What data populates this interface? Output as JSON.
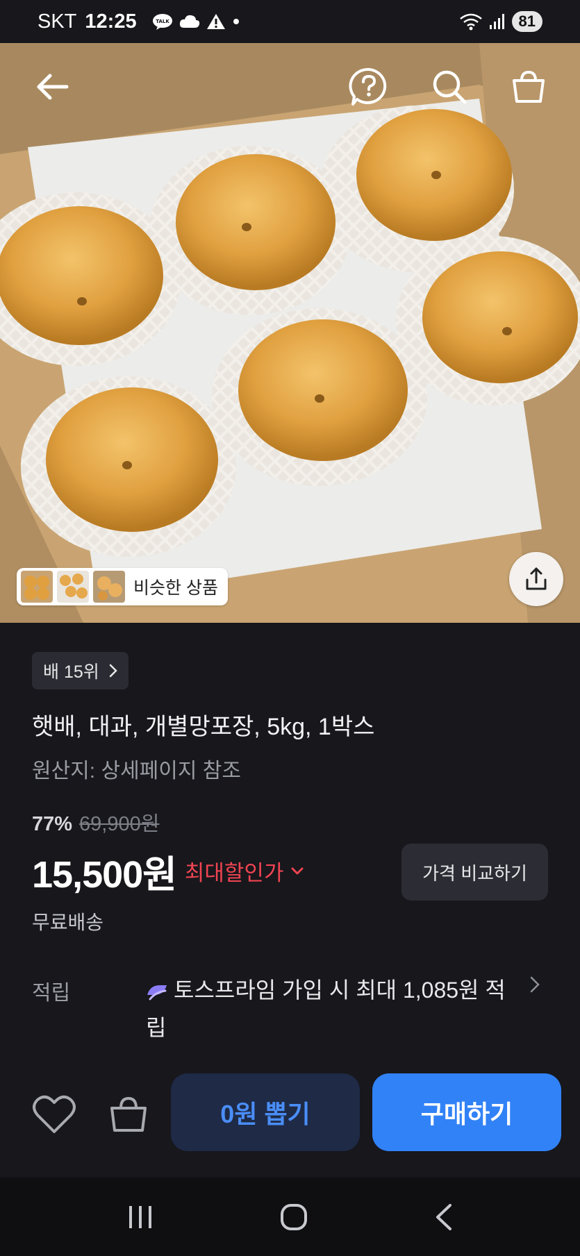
{
  "status_bar": {
    "carrier": "SKT",
    "time": "12:25",
    "battery": "81"
  },
  "hero": {
    "similar_label": "비슷한 상품"
  },
  "product": {
    "rank_badge": "배 15위",
    "title": "햇배, 대과, 개별망포장, 5kg, 1박스",
    "origin": "원산지: 상세페이지 참조",
    "discount_rate": "77%",
    "original_price": "69,900원",
    "price": "15,500원",
    "max_discount_label": "최대할인가",
    "compare_label": "가격 비교하기",
    "shipping": "무료배송",
    "points_label": "적립",
    "points_text": "토스프라임 가입 시 최대 1,085원 적립"
  },
  "actions": {
    "draw_label": "0원 뽑기",
    "buy_label": "구매하기"
  },
  "colors": {
    "background": "#17171c",
    "accent_blue": "#3182f6",
    "discount_red": "#f04452"
  },
  "icons": [
    "back-arrow-icon",
    "help-icon",
    "search-icon",
    "cart-icon",
    "share-icon",
    "heart-icon",
    "shopping-bag-icon",
    "chevron-right-icon",
    "chevron-down-icon"
  ]
}
